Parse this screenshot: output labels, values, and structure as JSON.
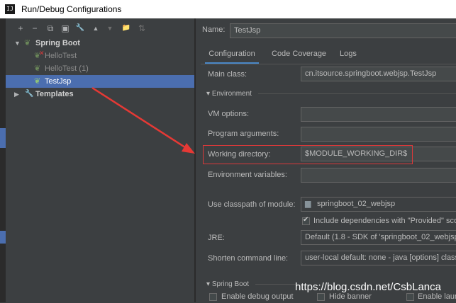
{
  "window": {
    "title": "Run/Debug Configurations",
    "app_icon": "IJ"
  },
  "toolbar": {
    "add": "+",
    "remove": "−",
    "copy": "⧉",
    "save": "▣",
    "wrench": "🔧",
    "up": "▲",
    "down": "▼",
    "folder": "📁",
    "sort": "⇅"
  },
  "tree": {
    "spring_boot": "Spring Boot",
    "hello_test": "HelloTest",
    "hello_test_1": "HelloTest (1)",
    "test_jsp": "TestJsp",
    "templates": "Templates"
  },
  "name": {
    "label": "Name:",
    "value": "TestJsp"
  },
  "tabs": [
    "Configuration",
    "Code Coverage",
    "Logs"
  ],
  "config": {
    "main_class_label": "Main class:",
    "main_class_value": "cn.itsource.springboot.webjsp.TestJsp",
    "environment_section": "Environment",
    "vm_options_label": "VM options:",
    "program_args_label": "Program arguments:",
    "working_dir_label": "Working directory:",
    "working_dir_value": "$MODULE_WORKING_DIR$",
    "env_vars_label": "Environment variables:",
    "classpath_label": "Use classpath of module:",
    "classpath_value": "springboot_02_webjsp",
    "include_deps_label": "Include dependencies with \"Provided\" sco",
    "jre_label": "JRE:",
    "jre_value": "Default (1.8 - SDK of 'springboot_02_webjsp'",
    "shorten_label": "Shorten command line:",
    "shorten_value": "user-local default: none - java [options] class",
    "spring_boot_section": "Spring Boot",
    "debug_output_label": "Enable debug output",
    "hide_banner_label": "Hide banner",
    "enable_launch_label": "Enable laun"
  },
  "watermark": "https://blog.csdn.net/CsbLanca",
  "colors": {
    "background": "#3c3f41",
    "selection": "#4b6eaf",
    "highlight_box": "#d9393a",
    "arrow": "#e53935"
  }
}
